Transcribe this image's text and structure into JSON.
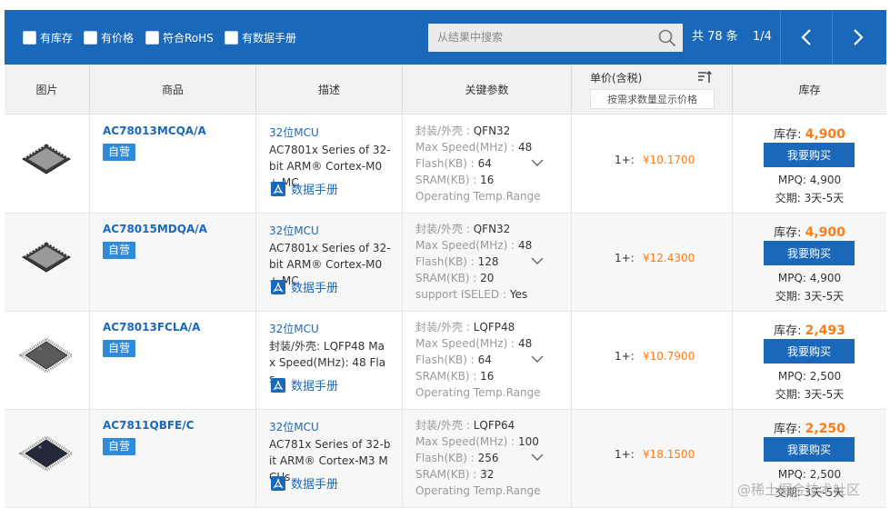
{
  "filters": [
    {
      "label": "有库存"
    },
    {
      "label": "有价格"
    },
    {
      "label": "符合RoHS"
    },
    {
      "label": "有数据手册"
    }
  ],
  "search": {
    "placeholder": "从结果中搜索"
  },
  "pagination": {
    "total": "共 78 条",
    "page": "1/4"
  },
  "columns": {
    "image": "图片",
    "product": "商品",
    "description": "描述",
    "params": "关键参数",
    "price": "单价(含税)",
    "price_hint": "按需求数量显示价格",
    "stock": "库存"
  },
  "colors": {
    "accent": "#1a68ba",
    "price": "#ff7b14",
    "tag": "#2f8bd8"
  },
  "rows": [
    {
      "part": "AC78013MCQA/A",
      "tag": "自营",
      "category": "32位MCU",
      "description": "AC7801x Series of 32-bit ARM® Cortex-M0+ MC",
      "datasheet": "数据手册",
      "params": [
        {
          "label": "封装/外壳 : ",
          "value": "QFN32"
        },
        {
          "label": "Max Speed(MHz) : ",
          "value": "48"
        },
        {
          "label": "Flash(KB) : ",
          "value": "64"
        },
        {
          "label": "SRAM(KB) : ",
          "value": "16"
        },
        {
          "label": "Operating Temp.Range",
          "value": ""
        }
      ],
      "tier": "1+:",
      "price": "¥10.1700",
      "stock_label": "库存: ",
      "stock_value": "4,900",
      "buy": "我要购买",
      "mpq": "MPQ: 4,900",
      "lead": "交期: 3天-5天",
      "chip_icon": "qfn-chip-icon"
    },
    {
      "part": "AC78015MDQA/A",
      "tag": "自营",
      "category": "32位MCU",
      "description": "AC7801x Series of 32-bit ARM® Cortex-M0+ MC",
      "datasheet": "数据手册",
      "params": [
        {
          "label": "封装/外壳 : ",
          "value": "QFN32"
        },
        {
          "label": "Max Speed(MHz) : ",
          "value": "48"
        },
        {
          "label": "Flash(KB) : ",
          "value": "128"
        },
        {
          "label": "SRAM(KB) : ",
          "value": "20"
        },
        {
          "label": "support ISELED : ",
          "value": "Yes"
        }
      ],
      "tier": "1+:",
      "price": "¥12.4300",
      "stock_label": "库存: ",
      "stock_value": "4,900",
      "buy": "我要购买",
      "mpq": "MPQ: 4,900",
      "lead": "交期: 3天-5天",
      "chip_icon": "qfn-chip-icon"
    },
    {
      "part": "AC78013FCLA/A",
      "tag": "自营",
      "category": "32位MCU",
      "description": "封装/外壳: LQFP48 Max Speed(MHz): 48 Flas",
      "datasheet": "数据手册",
      "params": [
        {
          "label": "封装/外壳 : ",
          "value": "LQFP48"
        },
        {
          "label": "Max Speed(MHz) : ",
          "value": "48"
        },
        {
          "label": "Flash(KB) : ",
          "value": "64"
        },
        {
          "label": "SRAM(KB) : ",
          "value": "16"
        },
        {
          "label": "Operating Temp.Range",
          "value": ""
        }
      ],
      "tier": "1+:",
      "price": "¥10.7900",
      "stock_label": "库存: ",
      "stock_value": "2,493",
      "buy": "我要购买",
      "mpq": "MPQ: 2,500",
      "lead": "交期: 3天-5天",
      "chip_icon": "lqfp-chip-icon"
    },
    {
      "part": "AC7811QBFE/C",
      "tag": "自营",
      "category": "32位MCU",
      "description": "AC781x Series of 32-bit ARM® Cortex-M3 MCUs",
      "datasheet": "数据手册",
      "params": [
        {
          "label": "封装/外壳 : ",
          "value": "LQFP64"
        },
        {
          "label": "Max Speed(MHz) : ",
          "value": "100"
        },
        {
          "label": "Flash(KB) : ",
          "value": "256"
        },
        {
          "label": "SRAM(KB) : ",
          "value": "32"
        },
        {
          "label": "Operating Temp.Range",
          "value": ""
        }
      ],
      "tier": "1+:",
      "price": "¥18.1500",
      "stock_label": "库存: ",
      "stock_value": "2,250",
      "buy": "我要购买",
      "mpq": "MPQ: 2,500",
      "lead": "交期: 3天-5天",
      "chip_icon": "lqfp-chip-icon"
    }
  ],
  "watermark": "@稀土掘金技术社区"
}
